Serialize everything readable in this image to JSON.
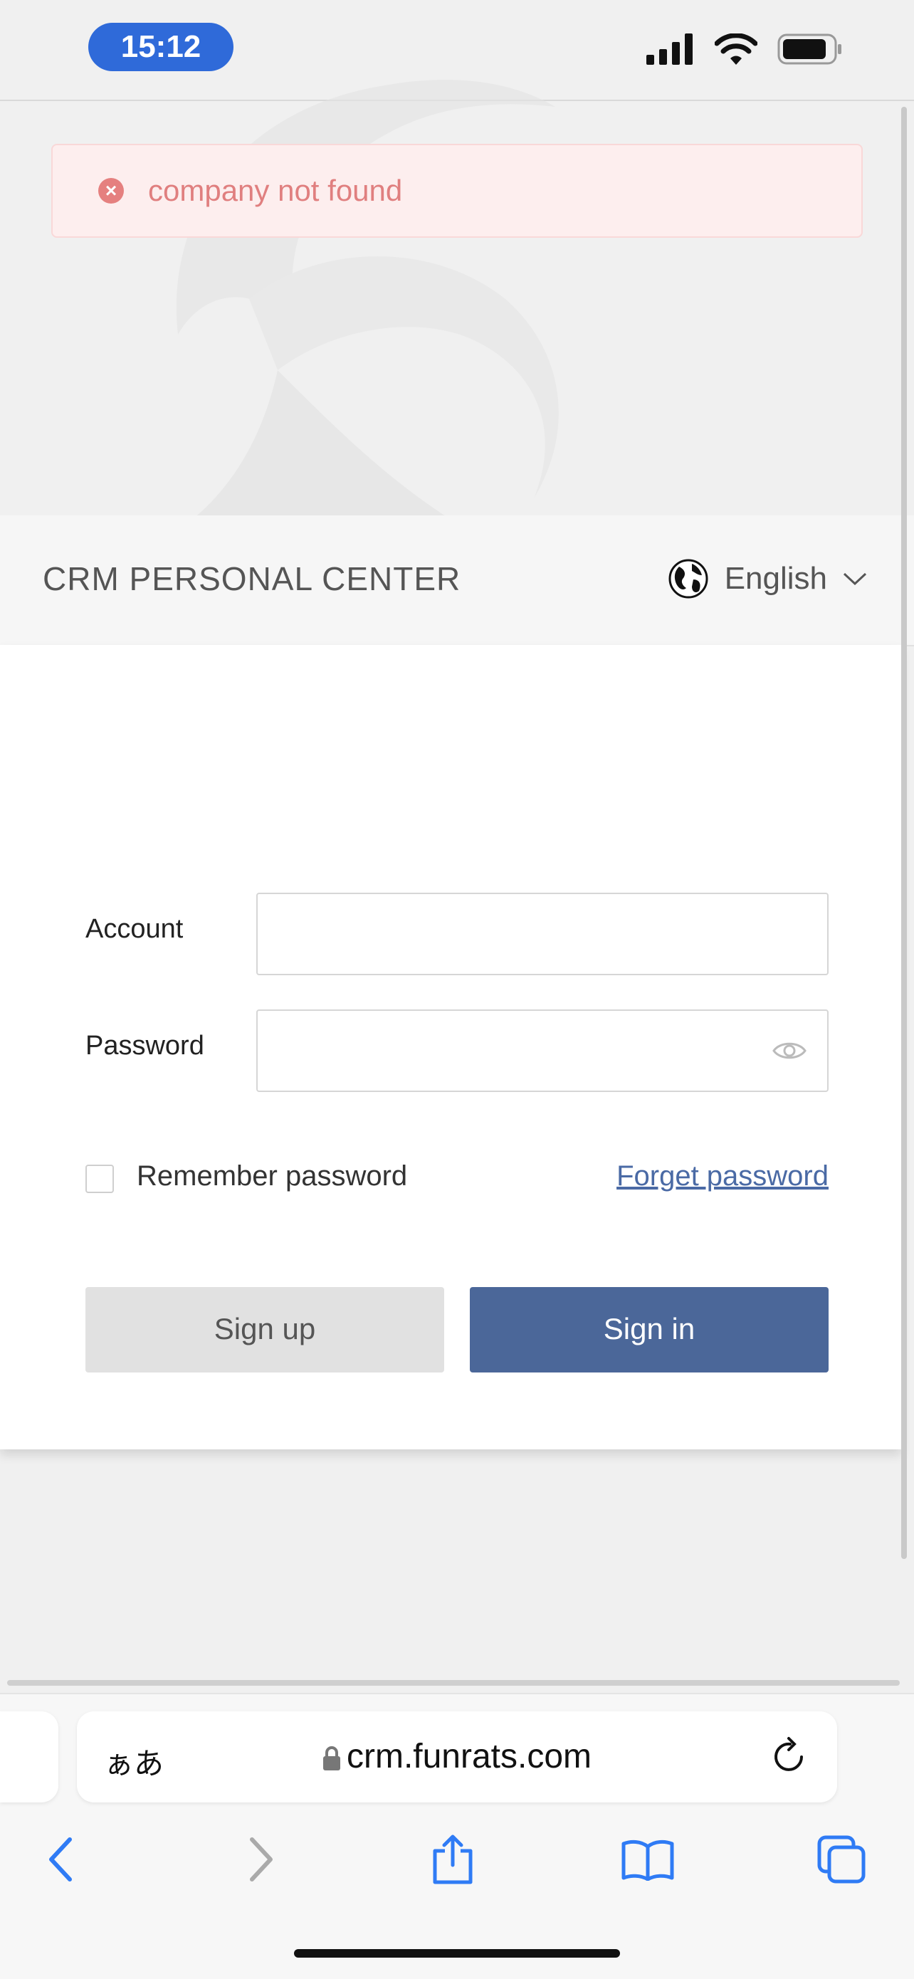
{
  "status_bar": {
    "time": "15:12"
  },
  "alert": {
    "message": "company not found"
  },
  "header": {
    "brand": "CRM PERSONAL CENTER",
    "language": "English"
  },
  "form": {
    "account_label": "Account",
    "account_value": "",
    "password_label": "Password",
    "password_value": "",
    "remember_label": "Remember password",
    "forget_label": "Forget password",
    "signup_label": "Sign up",
    "signin_label": "Sign in"
  },
  "browser": {
    "aa_label": "ぁあ",
    "url": "crm.funrats.com"
  },
  "icons": [
    "signal-icon",
    "wifi-icon",
    "battery-icon",
    "error-icon",
    "globe-icon",
    "chevron-down-icon",
    "eye-icon",
    "lock-icon",
    "reload-icon",
    "back-icon",
    "forward-icon",
    "share-icon",
    "bookmarks-icon",
    "tabs-icon"
  ],
  "colors": {
    "accent": "#4b6799",
    "error": "#e07f7f",
    "ios_blue": "#2f6ad9"
  }
}
